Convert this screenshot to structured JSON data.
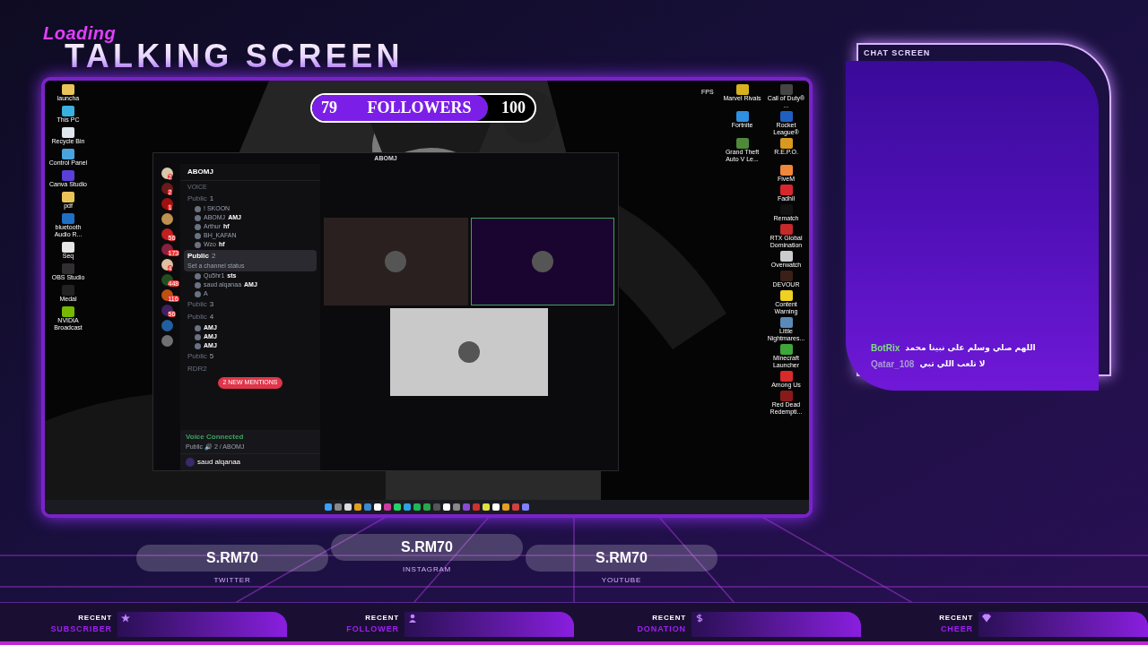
{
  "overlay": {
    "title_tag": "Loading",
    "title": "TALKING SCREEN"
  },
  "follower_goal": {
    "current": "79",
    "label": "FOLLOWERS",
    "target": "100",
    "level": 0.79
  },
  "desktop": {
    "fps_label": "FPS",
    "left_icons": [
      {
        "label": "launcha",
        "color": "#e8c35a"
      },
      {
        "label": "This PC",
        "color": "#3ab0e0"
      },
      {
        "label": "Recycle Bin",
        "color": "#dfe6ee"
      },
      {
        "label": "Control Panel",
        "color": "#4aa3df"
      },
      {
        "label": "Canva Studio",
        "color": "#5b3fd6"
      },
      {
        "label": "pdf",
        "color": "#e8c35a"
      },
      {
        "label": "bluetooth Audio R...",
        "color": "#1f6fc5"
      },
      {
        "label": "Seq",
        "color": "#e6e6e6"
      },
      {
        "label": "OBS Studio",
        "color": "#302e31"
      },
      {
        "label": "Medal",
        "color": "#222222"
      },
      {
        "label": "NVIDIA Broadcast",
        "color": "#76b900"
      }
    ],
    "right_icons": [
      {
        "label": "Marvel Rivals",
        "color": "#d8b21e"
      },
      {
        "label": "Call of Duty® ...",
        "color": "#444444"
      },
      {
        "label": "Fortnite",
        "color": "#2f8fe0"
      },
      {
        "label": "Rocket League®",
        "color": "#1f5fc2"
      },
      {
        "label": "Grand Theft Auto V Le...",
        "color": "#4e8a3a"
      },
      {
        "label": "R.E.P.O.",
        "color": "#d89a1e"
      },
      {
        "label": "FiveM",
        "color": "#f0873a"
      },
      {
        "label": "Fadhil",
        "color": "#d8262e"
      },
      {
        "label": "Rematch",
        "color": "#111111"
      },
      {
        "label": "RTX Global Domination",
        "color": "#c42a2a"
      },
      {
        "label": "Overwatch",
        "color": "#cccccc"
      },
      {
        "label": "DEVOUR",
        "color": "#3a2016"
      },
      {
        "label": "Content Warning",
        "color": "#f0d020"
      },
      {
        "label": "Little Nightmares...",
        "color": "#5a8ab8"
      },
      {
        "label": "Minecraft Launcher",
        "color": "#3fa63a"
      },
      {
        "label": "Among Us",
        "color": "#d82a2a"
      },
      {
        "label": "Red Dead Redempti...",
        "color": "#8a1a1a"
      }
    ]
  },
  "discord": {
    "window_title": "ABOMJ",
    "server_name": "ABOMJ",
    "section": "VOICE",
    "servers": [
      {
        "badge": "2",
        "color": "#d9c9a8"
      },
      {
        "badge": "2",
        "color": "#6b1a1a"
      },
      {
        "badge": "1",
        "color": "#a01010"
      },
      {
        "color": "#c09050"
      },
      {
        "badge": "56",
        "color": "#c02020"
      },
      {
        "badge": "173",
        "color": "#8a2040"
      },
      {
        "badge": "4",
        "color": "#e0c0a0"
      },
      {
        "badge": "448",
        "color": "#205020"
      },
      {
        "badge": "116",
        "color": "#c05010"
      },
      {
        "badge": "56",
        "color": "#402060"
      },
      {
        "color": "#2060a0"
      },
      {
        "color": "#707070"
      }
    ],
    "channels": [
      {
        "name": "Public",
        "number": "1",
        "selected": false,
        "users": [
          {
            "name": "! SKOON"
          },
          {
            "name": "ABOMJ",
            "tag": "AMJ"
          },
          {
            "name": "Arthur",
            "tag": "hf"
          },
          {
            "name": "BH_KAFAN"
          },
          {
            "name": "Wzo",
            "tag": "hf"
          }
        ]
      },
      {
        "name": "Public",
        "number": "2",
        "selected": true,
        "status": "Set a channel status",
        "users": [
          {
            "name": "Qu5hr1",
            "tag": "sts"
          },
          {
            "name": "saud alqanaa",
            "tag": "AMJ"
          },
          {
            "name": "A"
          }
        ]
      },
      {
        "name": "Public",
        "number": "3",
        "selected": false
      },
      {
        "name": "Public",
        "number": "4",
        "selected": false,
        "users": [
          {
            "tag": "AMJ"
          },
          {
            "tag": "AMJ"
          },
          {
            "tag": "AMJ"
          }
        ]
      },
      {
        "name": "Public",
        "number": "5",
        "selected": false
      },
      {
        "name": "RDR2",
        "selected": false
      }
    ],
    "mentions": "2 NEW MENTIONS",
    "voice_status": "Voice Connected",
    "voice_channel": "Public 🔊 2 / ABOMJ",
    "username": "saud alqanaa"
  },
  "chat": {
    "title": "CHAT SCREEN",
    "messages": [
      {
        "user": "BotRix",
        "color": "#7ee07e",
        "text": "اللهم صلي وسلم على نبينا محمد"
      },
      {
        "user": "Qatar_108",
        "color": "#a99ad8",
        "text": "لا تلعب اللي تبي"
      }
    ]
  },
  "socials": [
    {
      "handle": "S.RM70",
      "network": "TWITTER"
    },
    {
      "handle": "S.RM70",
      "network": "INSTAGRAM"
    },
    {
      "handle": "S.RM70",
      "network": "YOUTUBE"
    }
  ],
  "recent": [
    {
      "kind": "star",
      "top": "RECENT",
      "label": "SUBSCRIBER"
    },
    {
      "kind": "person",
      "top": "RECENT",
      "label": "FOLLOWER"
    },
    {
      "kind": "dollar",
      "top": "RECENT",
      "label": "DONATION"
    },
    {
      "kind": "diamond",
      "top": "RECENT",
      "label": "CHEER"
    }
  ]
}
